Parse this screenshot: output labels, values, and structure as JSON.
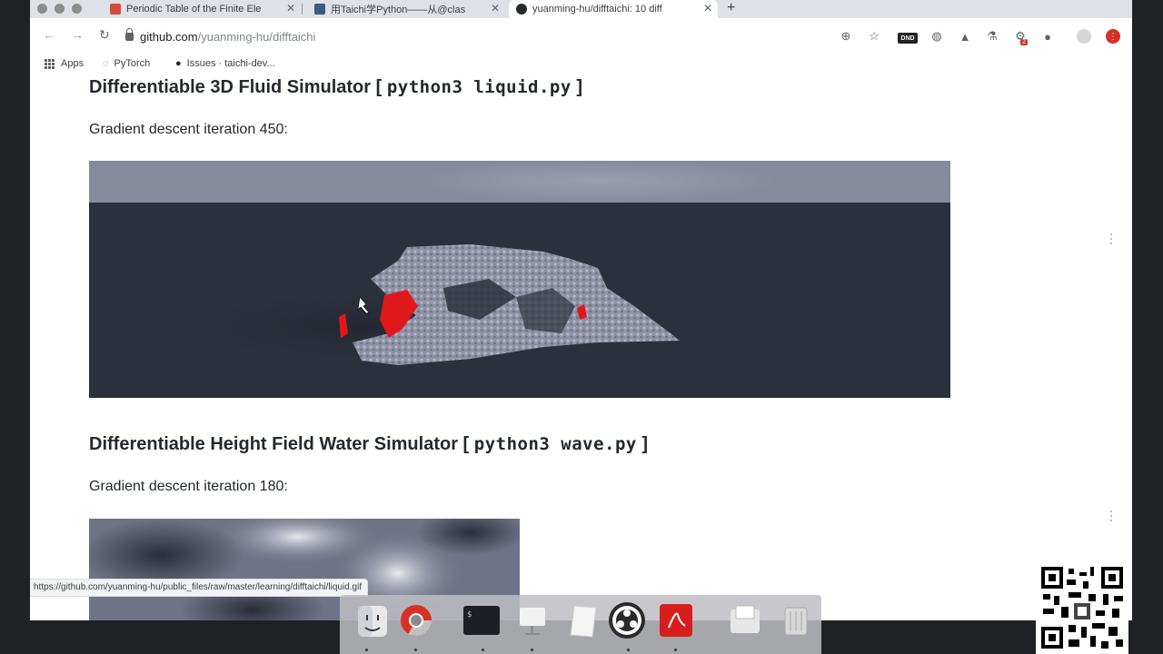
{
  "tabs": [
    {
      "title": "Periodic Table of the Finite Ele",
      "favicon_color": "#d44b3a"
    },
    {
      "title": "用Taichi学Python——从@clas",
      "favicon_color": "#3d5a80"
    },
    {
      "title": "yuanming-hu/difftaichi: 10 diff",
      "favicon_color": "#24292e",
      "active": true
    }
  ],
  "toolbar": {
    "url_host": "github.com",
    "url_path": "/yuanming-hu/difftaichi",
    "dnd_badge": "DND",
    "ext_count": "2"
  },
  "bookmarks": [
    {
      "label": "Apps",
      "icon": "apps-grid-icon"
    },
    {
      "label": "PyTorch",
      "icon": "pytorch-icon"
    },
    {
      "label": "Issues · taichi-dev...",
      "icon": "github-icon"
    }
  ],
  "content": {
    "section1": {
      "title_text": "Differentiable 3D Fluid Simulator [",
      "title_code": "python3 liquid.py",
      "title_end": "]",
      "caption": "Gradient descent iteration 450:"
    },
    "section2": {
      "title_text": "Differentiable Height Field Water Simulator [",
      "title_code": "python3 wave.py",
      "title_end": "]",
      "caption": "Gradient descent iteration 180:"
    }
  },
  "status_url": "https://github.com/yuanming-hu/public_files/raw/master/learning/difftaichi/liquid.gif",
  "colors": {
    "accent_red": "#d93025",
    "sim_background": "#2c303c",
    "sim_sky": "#878b9e",
    "particle_gray": "#9b9db0",
    "target_red": "#e0181b"
  },
  "dock": [
    {
      "name": "finder"
    },
    {
      "name": "chrome"
    },
    {
      "name": "terminal"
    },
    {
      "name": "keynote"
    },
    {
      "name": "paper"
    },
    {
      "name": "obs"
    },
    {
      "name": "acrobat"
    },
    {
      "name": "downloads"
    },
    {
      "name": "trash"
    }
  ]
}
